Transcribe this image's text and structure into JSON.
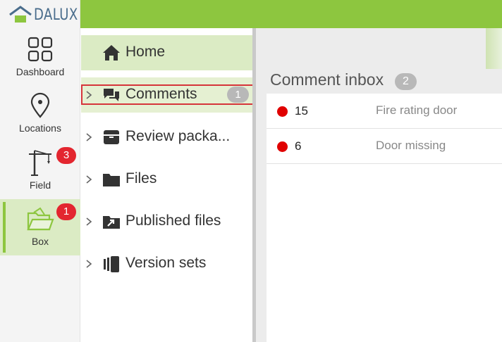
{
  "app": {
    "logo_text": "DALUX"
  },
  "colors": {
    "brand_green": "#8dc63f",
    "badge_red": "#e3262f",
    "status_red": "#e00000"
  },
  "rail": {
    "items": [
      {
        "label": "Dashboard",
        "icon": "grid-icon"
      },
      {
        "label": "Locations",
        "icon": "map-pin-icon"
      },
      {
        "label": "Field",
        "icon": "crane-icon",
        "badge": "3"
      },
      {
        "label": "Box",
        "icon": "folder-open-icon",
        "badge": "1",
        "active": true
      }
    ]
  },
  "nav": {
    "items": [
      {
        "label": "Home",
        "icon": "home-icon",
        "selected": true
      },
      {
        "label": "Comments",
        "icon": "comments-icon",
        "badge": "1"
      },
      {
        "label": "Review packa...",
        "icon": "box-archive-icon"
      },
      {
        "label": "Files",
        "icon": "folder-icon"
      },
      {
        "label": "Published files",
        "icon": "published-icon"
      },
      {
        "label": "Version sets",
        "icon": "version-sets-icon"
      }
    ]
  },
  "inbox": {
    "title": "Comment inbox",
    "count": "2",
    "rows": [
      {
        "number": "15",
        "description": "Fire rating door",
        "status": "red"
      },
      {
        "number": "6",
        "description": "Door missing",
        "status": "red"
      }
    ]
  }
}
